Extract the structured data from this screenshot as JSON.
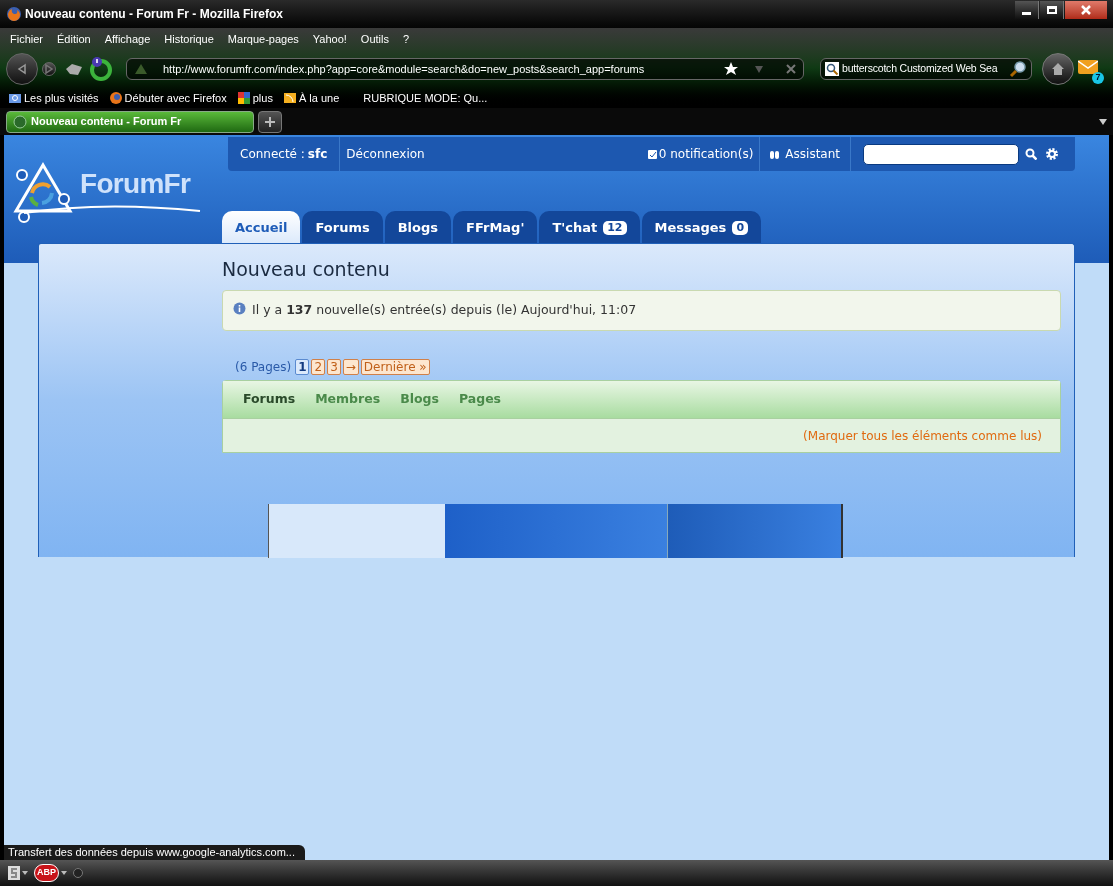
{
  "window": {
    "title": "Nouveau contenu - Forum Fr - Mozilla Firefox"
  },
  "menu": [
    "Fichier",
    "Édition",
    "Affichage",
    "Historique",
    "Marque-pages",
    "Yahoo!",
    "Outils",
    "?"
  ],
  "navigation": {
    "url": "http://www.forumfr.com/index.php?app=core&module=search&do=new_posts&search_app=forums",
    "search_value": "butterscotch Customized Web Sea",
    "mail_badge": "7"
  },
  "bookmarks": [
    {
      "label": "Les plus visités",
      "kind": "folder"
    },
    {
      "label": "Débuter avec Firefox",
      "kind": "firefox"
    },
    {
      "label": "plus",
      "kind": "google"
    },
    {
      "label": "À la une",
      "kind": "feed"
    },
    {
      "label": "RUBRIQUE MODE: Qu...",
      "kind": "plain"
    }
  ],
  "tabs": [
    {
      "label": "Nouveau contenu - Forum Fr",
      "selected": true
    }
  ],
  "site": {
    "logo": "ForumFr",
    "user_bar": {
      "connected_label": "Connecté :",
      "user": "sfc",
      "logout": "Déconnexion",
      "notifications": "0 notification(s)",
      "assistant": "Assistant"
    },
    "nav_tabs": [
      {
        "label": "Accueil",
        "selected": true
      },
      {
        "label": "Forums",
        "selected": false
      },
      {
        "label": "Blogs",
        "selected": false
      },
      {
        "label": "FFrMag'",
        "selected": false
      },
      {
        "label": "T'chat",
        "selected": false,
        "badge": "12"
      },
      {
        "label": "Messages",
        "selected": false,
        "badge": "0"
      }
    ],
    "heading": "Nouveau contenu",
    "info_message": "Il y a **137** nouvelle(s) entrée(s) depuis (le) Aujourd'hui, 11:07",
    "pagination": {
      "total": "(6 Pages)",
      "pages": [
        {
          "label": "1",
          "selected": true
        },
        {
          "label": "2",
          "selected": false
        },
        {
          "label": "3",
          "selected": false
        }
      ],
      "next": "→",
      "last": "Dernière »"
    },
    "section_tabs": [
      {
        "label": "Forums",
        "selected": true
      },
      {
        "label": "Membres",
        "selected": false
      },
      {
        "label": "Blogs",
        "selected": false
      },
      {
        "label": "Pages",
        "selected": false
      }
    ],
    "mark_read": "(Marquer tous les éléments comme lus)"
  },
  "status_bar": {
    "message": "Transfert des données depuis www.google-analytics.com...",
    "addon_label": "ABP"
  }
}
